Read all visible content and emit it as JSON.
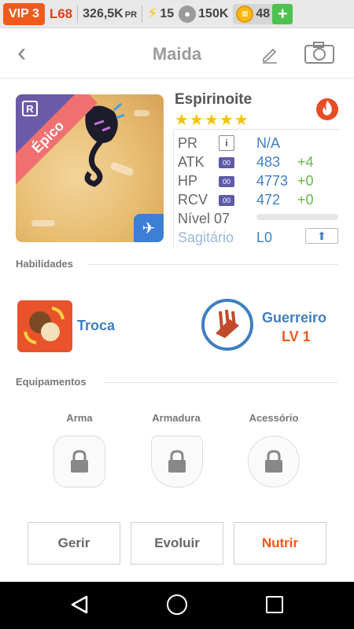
{
  "status": {
    "vip": "VIP 3",
    "level": "L68",
    "power": "326,5K",
    "power_unit": "PR",
    "energy": "15",
    "food": "150K",
    "gems": "48",
    "add": "+"
  },
  "header": {
    "back": "‹",
    "title": "Maida"
  },
  "monster": {
    "rarity_mark": "R",
    "rarity": "Épico",
    "element_symbol": "✈",
    "name": "Espirinoite",
    "stars": "★★★★★",
    "star_count": 5,
    "stats": {
      "pr": {
        "label": "PR",
        "tag": "i",
        "value": "N/A"
      },
      "atk": {
        "label": "ATK",
        "tag": "00",
        "value": "483",
        "delta": "+4"
      },
      "hp": {
        "label": "HP",
        "tag": "00",
        "value": "4773",
        "delta": "+0"
      },
      "rcv": {
        "label": "RCV",
        "tag": "00",
        "value": "472",
        "delta": "+0"
      }
    },
    "level_label": "Nível 07",
    "xp_progress": 0,
    "sign": "Sagitário",
    "sign_level": "L0",
    "upgrade_symbol": "⬆"
  },
  "skills": {
    "section_title": "Habilidades",
    "skill_name": "Troca",
    "class_name": "Guerreiro",
    "class_level": "LV 1"
  },
  "equipment": {
    "section_title": "Equipamentos",
    "slots": [
      "Arma",
      "Armadura",
      "Acessório"
    ]
  },
  "actions": {
    "manage": "Gerir",
    "evolve": "Evoluir",
    "feed": "Nutrir"
  },
  "colors": {
    "accent_orange": "#f05a1c",
    "link_blue": "#3f7fc2",
    "delta_green": "#69b84a",
    "star_yellow": "#f5c400"
  }
}
